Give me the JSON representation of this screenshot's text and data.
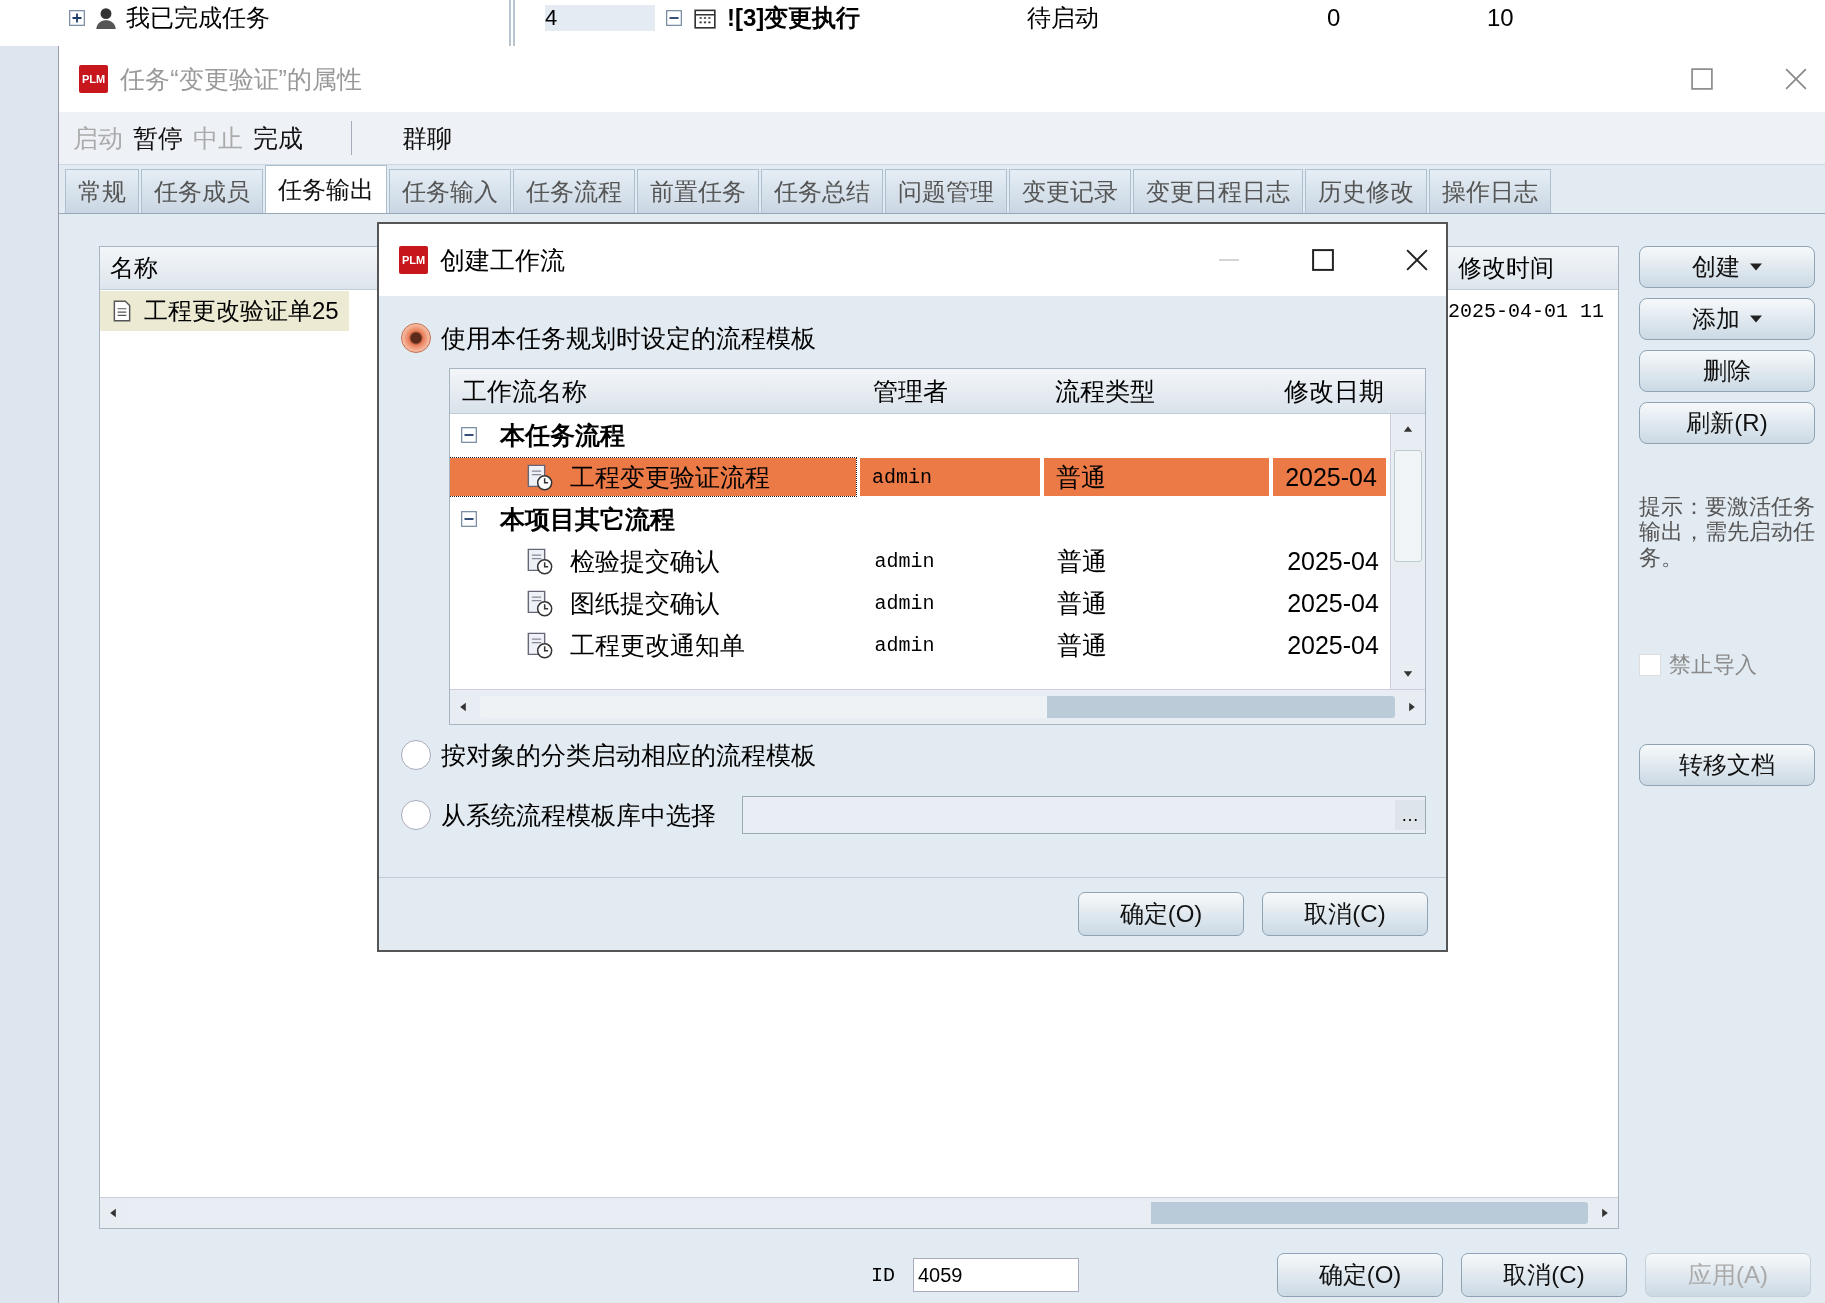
{
  "background": {
    "tree_item": "我已完成任务",
    "row": {
      "number": "4",
      "name": "![3]变更执行",
      "status": "待启动",
      "column_4": "0",
      "column_5": "10"
    }
  },
  "window": {
    "logo": "PLM",
    "title": "任务“变更验证”的属性"
  },
  "toolbar": [
    [
      {
        "label": "启动",
        "disabled": true
      },
      {
        "label": "暂停",
        "disabled": false
      },
      {
        "label": "中止",
        "disabled": true
      },
      {
        "label": "完成",
        "disabled": false
      }
    ],
    [
      {
        "label": "群聊",
        "disabled": false
      }
    ]
  ],
  "tabs": [
    {
      "label": "常规",
      "selected": false
    },
    {
      "label": "任务成员",
      "selected": false
    },
    {
      "label": "任务输出",
      "selected": true
    },
    {
      "label": "任务输入",
      "selected": false
    },
    {
      "label": "任务流程",
      "selected": false
    },
    {
      "label": "前置任务",
      "selected": false
    },
    {
      "label": "任务总结",
      "selected": false
    },
    {
      "label": "问题管理",
      "selected": false
    },
    {
      "label": "变更记录",
      "selected": false
    },
    {
      "label": "变更日程日志",
      "selected": false
    },
    {
      "label": "历史修改",
      "selected": false
    },
    {
      "label": "操作日志",
      "selected": false
    }
  ],
  "output_table": {
    "columns": [
      "名称",
      "修改时间"
    ],
    "rows": [
      {
        "name": "工程更改验证单25",
        "modified": "2025-04-01 11",
        "selected": true
      }
    ]
  },
  "side_buttons": [
    {
      "label": "创建",
      "dropdown": true
    },
    {
      "label": "添加",
      "dropdown": true
    },
    {
      "label": "删除",
      "dropdown": false
    },
    {
      "label": "刷新(R)",
      "dropdown": false
    }
  ],
  "hint": "提示：要激活任务输出，需先启动任务。",
  "checkbox": {
    "label": "禁止导入",
    "checked": false,
    "disabled": true
  },
  "transfer_button": "转移文档",
  "footer": {
    "id_label": "ID",
    "id_value": "4059",
    "buttons": [
      {
        "label": "确定(O)",
        "disabled": false
      },
      {
        "label": "取消(C)",
        "disabled": false
      },
      {
        "label": "应用(A)",
        "disabled": true
      }
    ]
  },
  "dialog": {
    "logo": "PLM",
    "title": "创建工作流",
    "options": [
      {
        "label": "使用本任务规划时设定的流程模板",
        "selected": true
      },
      {
        "label": "按对象的分类启动相应的流程模板",
        "selected": false
      },
      {
        "label": "从系统流程模板库中选择",
        "selected": false
      }
    ],
    "browse_button": "…",
    "table": {
      "columns": [
        "工作流名称",
        "管理者",
        "流程类型",
        "修改日期"
      ],
      "groups": [
        {
          "name": "本任务流程",
          "expanded": true,
          "rows": [
            {
              "name": "工程变更验证流程",
              "manager": "admin",
              "type": "普通",
              "date": "2025-04",
              "selected": true
            }
          ]
        },
        {
          "name": "本项目其它流程",
          "expanded": true,
          "rows": [
            {
              "name": "检验提交确认",
              "manager": "admin",
              "type": "普通",
              "date": "2025-04",
              "selected": false
            },
            {
              "name": "图纸提交确认",
              "manager": "admin",
              "type": "普通",
              "date": "2025-04",
              "selected": false
            },
            {
              "name": "工程更改通知单",
              "manager": "admin",
              "type": "普通",
              "date": "2025-04",
              "selected": false
            }
          ]
        }
      ]
    },
    "buttons": [
      {
        "label": "确定(O)"
      },
      {
        "label": "取消(C)"
      }
    ]
  }
}
